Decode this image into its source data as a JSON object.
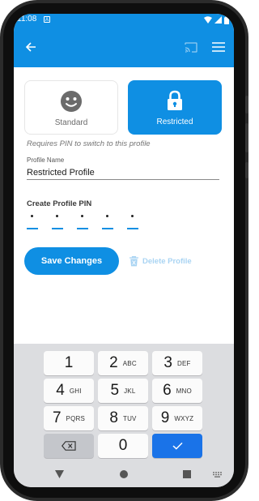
{
  "status_bar": {
    "time": "11:08",
    "notification_icon": "android-debug-icon",
    "right_icons": [
      "wifi-icon",
      "signal-icon",
      "battery-icon"
    ]
  },
  "app_bar": {
    "back_icon": "arrow-back-icon",
    "cast_icon": "cast-icon",
    "menu_icon": "hamburger-menu-icon"
  },
  "profile_types": [
    {
      "label": "Standard",
      "icon": "smiley-icon",
      "selected": false
    },
    {
      "label": "Restricted",
      "icon": "lock-icon",
      "selected": true
    }
  ],
  "pin_hint": "Requires PIN to switch to this profile",
  "profile_name": {
    "label": "Profile Name",
    "value": "Restricted Profile"
  },
  "create_pin": {
    "label": "Create Profile PIN",
    "digits_entered": 5,
    "slots": 5
  },
  "actions": {
    "save_label": "Save Changes",
    "delete_label": "Delete Profile",
    "delete_icon": "trash-icon"
  },
  "keypad": {
    "rows": [
      [
        {
          "num": "1",
          "letters": ""
        },
        {
          "num": "2",
          "letters": "ABC"
        },
        {
          "num": "3",
          "letters": "DEF"
        }
      ],
      [
        {
          "num": "4",
          "letters": "GHI"
        },
        {
          "num": "5",
          "letters": "JKL"
        },
        {
          "num": "6",
          "letters": "MNO"
        }
      ],
      [
        {
          "num": "7",
          "letters": "PQRS"
        },
        {
          "num": "8",
          "letters": "TUV"
        },
        {
          "num": "9",
          "letters": "WXYZ"
        }
      ],
      [
        {
          "special": "backspace-icon"
        },
        {
          "num": "0",
          "letters": ""
        },
        {
          "special": "checkmark-icon"
        }
      ]
    ]
  },
  "nav_bar": {
    "icons": [
      "back-triangle-icon",
      "home-circle-icon",
      "recents-square-icon",
      "keyboard-switch-icon"
    ]
  },
  "colors": {
    "primary": "#0f8fe3",
    "keyboard_bg": "#dcdde0",
    "enter_key": "#1a73e8",
    "disabled_text": "#a9d4f3"
  }
}
